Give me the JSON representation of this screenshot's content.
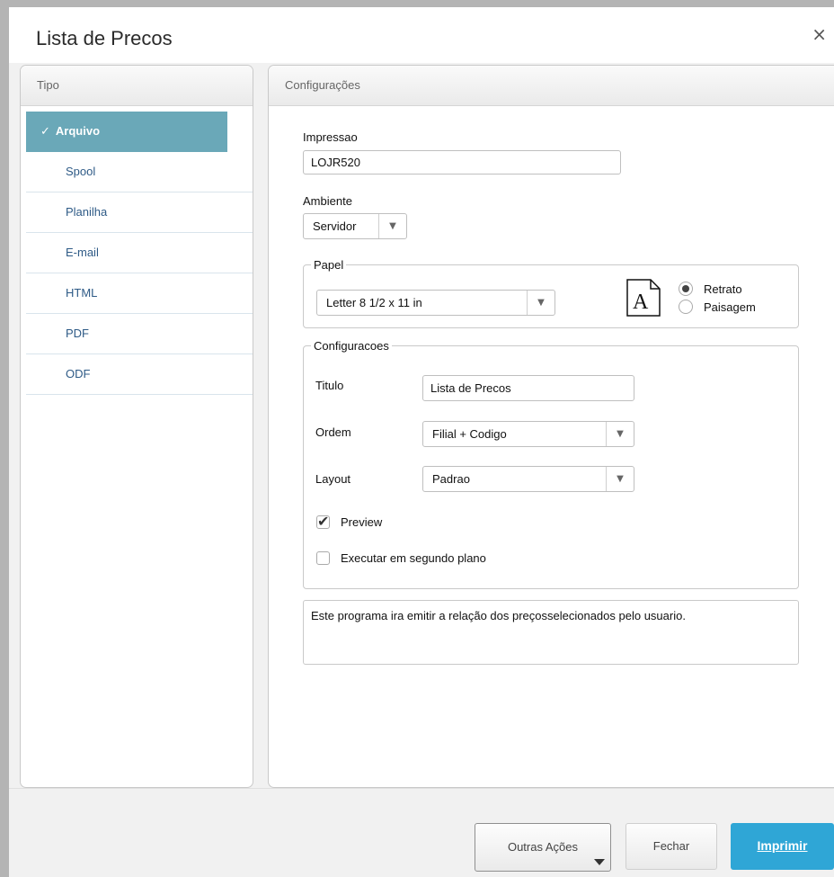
{
  "dialog": {
    "title": "Lista de Precos",
    "close_label": "×"
  },
  "left_panel": {
    "header": "Tipo",
    "items": [
      {
        "label": "Arquivo",
        "active": true,
        "check": "✓"
      },
      {
        "label": "Spool"
      },
      {
        "label": "Planilha"
      },
      {
        "label": "E-mail"
      },
      {
        "label": "HTML"
      },
      {
        "label": "PDF"
      },
      {
        "label": "ODF"
      }
    ]
  },
  "right_panel": {
    "header": "Configurações",
    "impressao": {
      "label": "Impressao",
      "value": "LOJR520"
    },
    "ambiente": {
      "label": "Ambiente",
      "value": "Servidor"
    },
    "papel": {
      "legend": "Papel",
      "size_value": "Letter 8 1/2 x 11 in",
      "icon": "page-a-icon",
      "icon_letter": "A",
      "orientation": [
        {
          "label": "Retrato",
          "selected": true
        },
        {
          "label": "Paisagem",
          "selected": false
        }
      ]
    },
    "configuracoes": {
      "legend": "Configuracoes",
      "titulo": {
        "label": "Titulo",
        "value": "Lista de Precos"
      },
      "ordem": {
        "label": "Ordem",
        "value": "Filial + Codigo"
      },
      "layout": {
        "label": "Layout",
        "value": "Padrao"
      },
      "preview": {
        "label": "Preview",
        "checked": true
      },
      "background": {
        "label": "Executar em segundo plano",
        "checked": false
      }
    },
    "description": "Este programa ira emitir a relação dos preçosselecionados pelo usuario."
  },
  "footer": {
    "outras": "Outras Ações",
    "fechar": "Fechar",
    "imprimir": "Imprimir"
  },
  "colors": {
    "active_item": "#6aa8b8",
    "primary_button": "#2fa6d6"
  }
}
